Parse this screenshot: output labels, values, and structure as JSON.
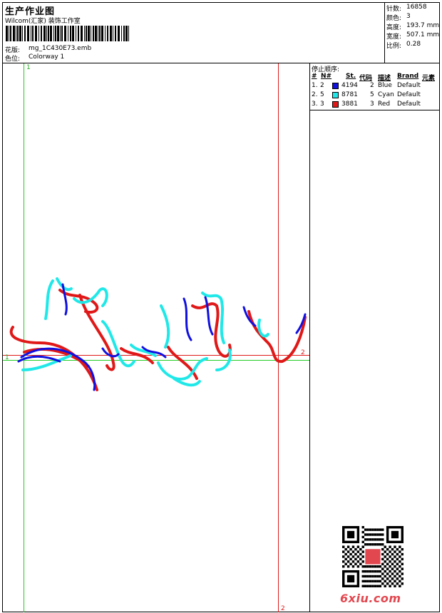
{
  "header": {
    "title": "生产作业图",
    "company": "Wilcom(汇家) 装饰工作室",
    "file_label": "花版:",
    "file_value": "mg_1C430E73.emb",
    "colorway_label": "色位:",
    "colorway_value": "Colorway 1"
  },
  "stats": [
    {
      "label": "针数:",
      "value": "16858"
    },
    {
      "label": "颜色:",
      "value": "3"
    },
    {
      "label": "高度:",
      "value": "193.7 mm"
    },
    {
      "label": "宽度:",
      "value": "507.1 mm"
    },
    {
      "label": "比例:",
      "value": "0.28"
    }
  ],
  "stop_sequence": {
    "label": "停止顺序:",
    "headers": [
      "#",
      "N#",
      "St.",
      "代码",
      "描述",
      "Brand",
      "元素"
    ],
    "rows": [
      {
        "num": "1.",
        "n": "2",
        "color": "#1010e0",
        "stitches": "4194",
        "code": "2",
        "desc": "Blue",
        "brand": "Default"
      },
      {
        "num": "2.",
        "n": "5",
        "color": "#20e8e8",
        "stitches": "8781",
        "code": "5",
        "desc": "Cyan",
        "brand": "Default"
      },
      {
        "num": "3.",
        "n": "3",
        "color": "#e01818",
        "stitches": "3881",
        "code": "3",
        "desc": "Red",
        "brand": "Default"
      }
    ]
  },
  "markers": {
    "top_green": "1",
    "left_green": "1",
    "right_red": "2",
    "bottom_red": "2"
  },
  "colors": {
    "blue": "#1010e0",
    "cyan": "#20e8e8",
    "red": "#e01818",
    "green": "#22cc22"
  },
  "watermark": "6xiu.com",
  "qr_seal": "爱绣网"
}
